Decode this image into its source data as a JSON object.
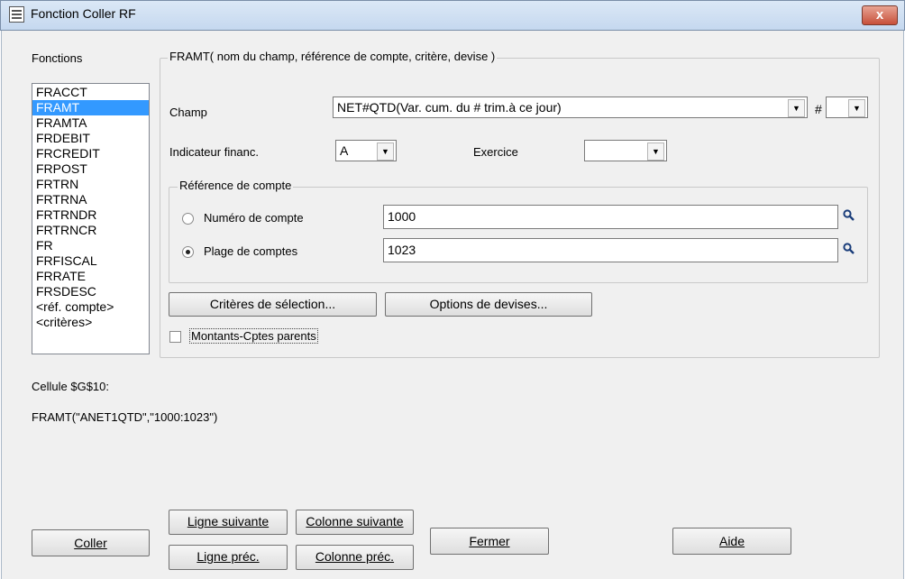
{
  "window": {
    "title": "Fonction Coller RF",
    "close_glyph": "x"
  },
  "functions": {
    "label": "Fonctions",
    "items": [
      "FRACCT",
      "FRAMT",
      "FRAMTA",
      "FRDEBIT",
      "FRCREDIT",
      "FRPOST",
      "FRTRN",
      "FRTRNA",
      "FRTRNDR",
      "FRTRNCR",
      "FR",
      "FRFISCAL",
      "FRRATE",
      "FRSDESC",
      "<réf. compte>",
      "<critères>"
    ],
    "selected": "FRAMT"
  },
  "formula_group": {
    "legend": "FRAMT( nom du champ, référence de compte, critère, devise )",
    "champ_label": "Champ",
    "champ_value": "NET#QTD(Var. cum. du # trim.à ce jour)",
    "hash_label": "#",
    "hash_value": "",
    "indicateur_label": "Indicateur financ.",
    "indicateur_value": "A",
    "exercice_label": "Exercice",
    "exercice_value": ""
  },
  "account_ref": {
    "legend": "Référence de compte",
    "numero_label": "Numéro de compte",
    "numero_value": "1000",
    "plage_label": "Plage de comptes",
    "plage_value": "1023",
    "selected_option": "Plage de comptes"
  },
  "buttons": {
    "criteres": "Critères de sélection...",
    "devises": "Options de devises...",
    "coller": "Coller",
    "ligne_suivante": "Ligne suivante",
    "colonne_suivante": "Colonne suivante",
    "ligne_prec": "Ligne préc.",
    "colonne_prec": "Colonne préc.",
    "fermer": "Fermer",
    "aide": "Aide"
  },
  "checkbox": {
    "label": "Montants-Cptes parents",
    "checked": false
  },
  "cell": {
    "label": "Cellule  $G$10:",
    "formula": "FRAMT(\"ANET1QTD\",\"1000:1023\")"
  }
}
